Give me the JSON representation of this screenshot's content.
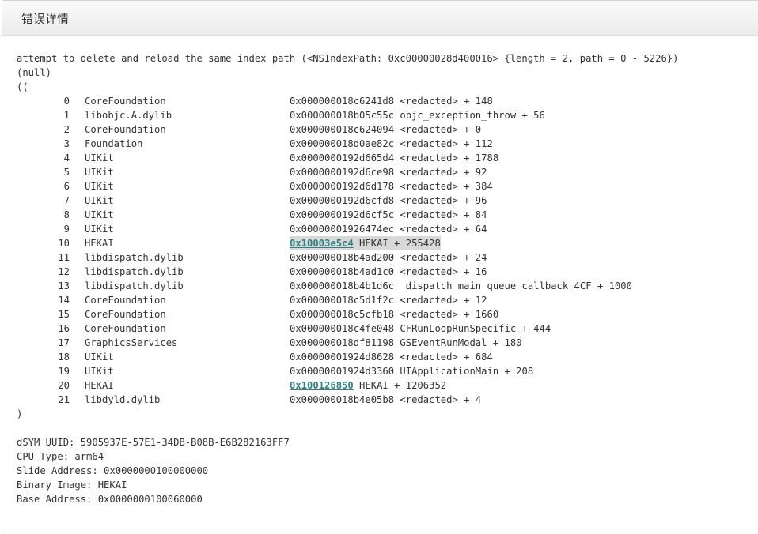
{
  "panel": {
    "title": "错误详情"
  },
  "log": {
    "message": "attempt to delete and reload the same index path (<NSIndexPath: 0xc00000028d400016> {length = 2, path = 0 - 5226})",
    "null_line": "(null)",
    "open_paren": "((",
    "close_paren": ")",
    "frames": [
      {
        "num": "0",
        "lib": "CoreFoundation",
        "addr": "0x000000018c6241d8",
        "sym": " <redacted> + 148",
        "link": false
      },
      {
        "num": "1",
        "lib": "libobjc.A.dylib",
        "addr": "0x000000018b05c55c",
        "sym": " objc_exception_throw + 56",
        "link": false
      },
      {
        "num": "2",
        "lib": "CoreFoundation",
        "addr": "0x000000018c624094",
        "sym": " <redacted> + 0",
        "link": false
      },
      {
        "num": "3",
        "lib": "Foundation",
        "addr": "0x000000018d0ae82c",
        "sym": " <redacted> + 112",
        "link": false
      },
      {
        "num": "4",
        "lib": "UIKit",
        "addr": "0x0000000192d665d4",
        "sym": " <redacted> + 1788",
        "link": false
      },
      {
        "num": "5",
        "lib": "UIKit",
        "addr": "0x0000000192d6ce98",
        "sym": " <redacted> + 92",
        "link": false
      },
      {
        "num": "6",
        "lib": "UIKit",
        "addr": "0x0000000192d6d178",
        "sym": " <redacted> + 384",
        "link": false
      },
      {
        "num": "7",
        "lib": "UIKit",
        "addr": "0x0000000192d6cfd8",
        "sym": " <redacted> + 96",
        "link": false
      },
      {
        "num": "8",
        "lib": "UIKit",
        "addr": "0x0000000192d6cf5c",
        "sym": " <redacted> + 84",
        "link": false
      },
      {
        "num": "9",
        "lib": "UIKit",
        "addr": "0x00000001926474ec",
        "sym": " <redacted> + 64",
        "link": false
      },
      {
        "num": "10",
        "lib": "HEKAI",
        "addr": "0x10003e5c4",
        "sym": " HEKAI + 255428",
        "link": true,
        "highlight": true
      },
      {
        "num": "11",
        "lib": "libdispatch.dylib",
        "addr": "0x000000018b4ad200",
        "sym": " <redacted> + 24",
        "link": false
      },
      {
        "num": "12",
        "lib": "libdispatch.dylib",
        "addr": "0x000000018b4ad1c0",
        "sym": " <redacted> + 16",
        "link": false
      },
      {
        "num": "13",
        "lib": "libdispatch.dylib",
        "addr": "0x000000018b4b1d6c",
        "sym": " _dispatch_main_queue_callback_4CF + 1000",
        "link": false
      },
      {
        "num": "14",
        "lib": "CoreFoundation",
        "addr": "0x000000018c5d1f2c",
        "sym": " <redacted> + 12",
        "link": false
      },
      {
        "num": "15",
        "lib": "CoreFoundation",
        "addr": "0x000000018c5cfb18",
        "sym": " <redacted> + 1660",
        "link": false
      },
      {
        "num": "16",
        "lib": "CoreFoundation",
        "addr": "0x000000018c4fe048",
        "sym": " CFRunLoopRunSpecific + 444",
        "link": false
      },
      {
        "num": "17",
        "lib": "GraphicsServices",
        "addr": "0x000000018df81198",
        "sym": " GSEventRunModal + 180",
        "link": false
      },
      {
        "num": "18",
        "lib": "UIKit",
        "addr": "0x00000001924d8628",
        "sym": " <redacted> + 684",
        "link": false
      },
      {
        "num": "19",
        "lib": "UIKit",
        "addr": "0x00000001924d3360",
        "sym": " UIApplicationMain + 208",
        "link": false
      },
      {
        "num": "20",
        "lib": "HEKAI",
        "addr": "0x100126850",
        "sym": " HEKAI + 1206352",
        "link": true
      },
      {
        "num": "21",
        "lib": "libdyld.dylib",
        "addr": "0x000000018b4e05b8",
        "sym": " <redacted> + 4",
        "link": false
      }
    ]
  },
  "meta": {
    "dsym": "dSYM UUID: 5905937E-57E1-34DB-B08B-E6B282163FF7",
    "cpu": "CPU Type: arm64",
    "slide": "Slide Address: 0x0000000100000000",
    "binary": "Binary Image: HEKAI",
    "base": "Base Address: 0x0000000100060000"
  },
  "colors": {
    "link": "#2f7f83",
    "highlight": "#d9d9d9",
    "text": "#333333"
  }
}
